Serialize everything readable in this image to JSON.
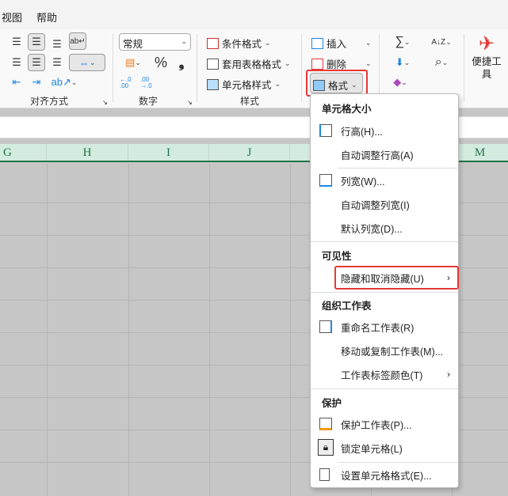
{
  "menubar": {
    "tabs": [
      "视图",
      "帮助"
    ]
  },
  "ribbon": {
    "alignment": {
      "label": "对齐方式"
    },
    "number": {
      "format_value": "常规",
      "percent": "%",
      "comma": "❟",
      "inc_decimal": "←.0 .00",
      "dec_decimal": ".00 →.0",
      "label": "数字"
    },
    "styles": {
      "conditional": "条件格式",
      "table": "套用表格格式",
      "cell": "单元格样式",
      "label": "样式"
    },
    "cells": {
      "insert": "插入",
      "delete": "删除",
      "format": "格式"
    },
    "editing": {
      "sum": "∑",
      "sort": "A↓Z",
      "find": "⌕"
    },
    "tools": {
      "label": "便捷工具"
    }
  },
  "columns": [
    "G",
    "H",
    "I",
    "J",
    "M"
  ],
  "menu": {
    "sections": {
      "size": "单元格大小",
      "visibility": "可见性",
      "organize": "组织工作表",
      "protect": "保护"
    },
    "items": {
      "row_height": "行高(H)...",
      "autofit_row": "自动调整行高(A)",
      "col_width": "列宽(W)...",
      "autofit_col": "自动调整列宽(I)",
      "default_width": "默认列宽(D)...",
      "hide_unhide": "隐藏和取消隐藏(U)",
      "rename": "重命名工作表(R)",
      "move_copy": "移动或复制工作表(M)...",
      "tab_color": "工作表标签颜色(T)",
      "protect_sheet": "保护工作表(P)...",
      "lock_cell": "锁定单元格(L)",
      "format_cells": "设置单元格格式(E)..."
    }
  },
  "colors": {
    "accent": "#217346",
    "highlight": "#e53935"
  }
}
